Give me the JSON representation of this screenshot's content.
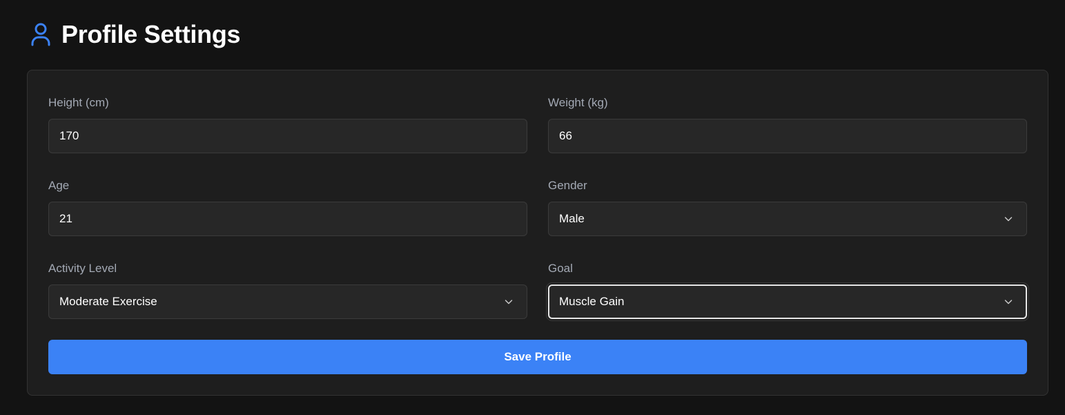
{
  "header": {
    "title": "Profile Settings",
    "icon": "user-icon",
    "icon_color": "#3b82f6"
  },
  "form": {
    "height": {
      "label": "Height (cm)",
      "value": "170"
    },
    "weight": {
      "label": "Weight (kg)",
      "value": "66"
    },
    "age": {
      "label": "Age",
      "value": "21"
    },
    "gender": {
      "label": "Gender",
      "value": "Male",
      "icon": "chevron-down-icon"
    },
    "activity": {
      "label": "Activity Level",
      "value": "Moderate Exercise",
      "icon": "chevron-down-icon"
    },
    "goal": {
      "label": "Goal",
      "value": "Muscle Gain",
      "icon": "chevron-down-icon",
      "focused": true
    },
    "save_label": "Save Profile",
    "save_color": "#3b82f6"
  }
}
